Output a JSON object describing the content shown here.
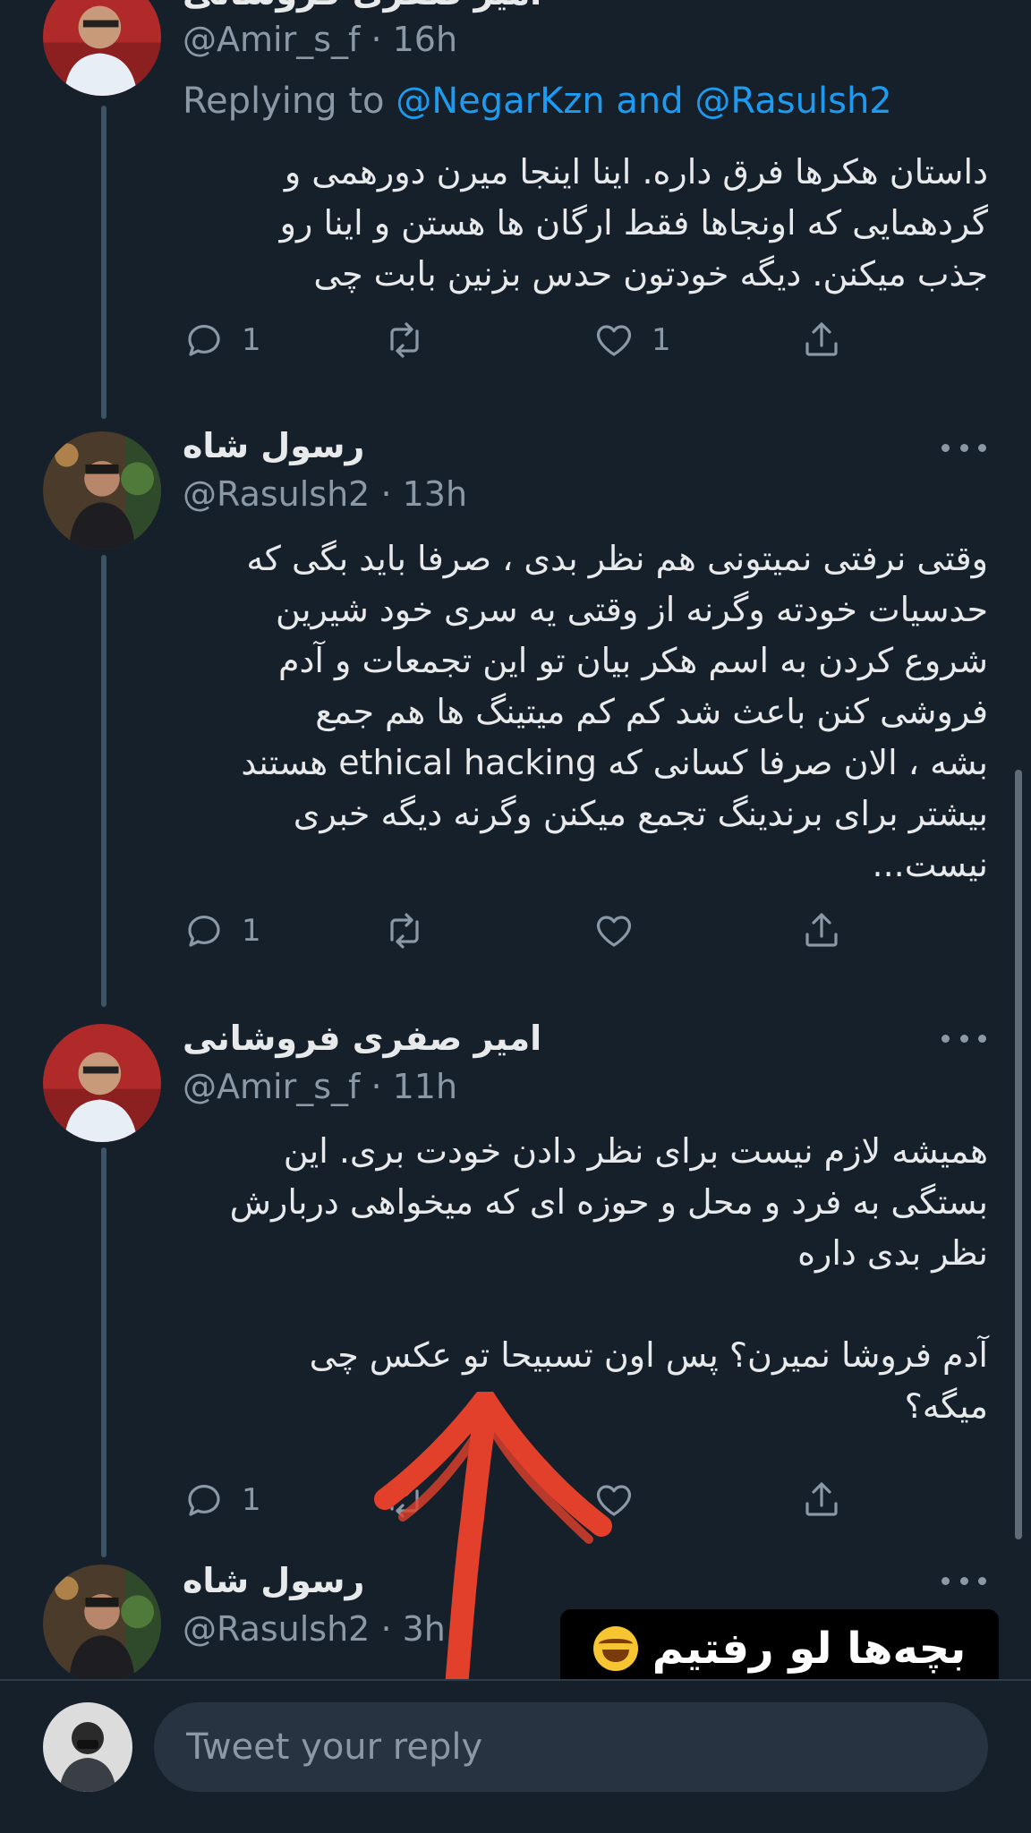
{
  "tweets": [
    {
      "name": "امیر صفری فروشانی",
      "handle": "@Amir_s_f",
      "time": "16h",
      "replying_prefix": "Replying to ",
      "replying_to": "@NegarKzn and @Rasulsh2",
      "text": "داستان هکرها فرق داره. اینا اینجا میرن دورهمی و\nگردهمایی که اونجاها فقط ارگان ها هستن و اینا رو\nجذب میکنن. دیگه خودتون حدس بزنین بابت چی",
      "reply_count": "1",
      "retweet_count": "",
      "like_count": "1"
    },
    {
      "name": "رسول شاه",
      "handle": "@Rasulsh2",
      "time": "13h",
      "text": "وقتی نرفتی نمیتونی هم نظر بدی ، صرفا باید بگی که\nحدسیات خودته وگرنه از وقتی یه سری خود شیرین\nشروع کردن به اسم هکر بیان تو این تجمعات و آدم\nفروشی کنن باعث شد کم کم میتینگ ها هم جمع\nبشه ، الان صرفا کسانی که ethical hacking هستند\nبیشتر برای برندینگ تجمع میکنن وگرنه دیگه خبری\nنیست...",
      "reply_count": "1",
      "retweet_count": "",
      "like_count": ""
    },
    {
      "name": "امیر صفری فروشانی",
      "handle": "@Amir_s_f",
      "time": "11h",
      "text": "همیشه لازم نیست برای نظر دادن خودت بری. این\nبستگی به فرد و محل و حوزه ای که میخواهی دربارش\nنظر بدی داره\n\nآدم فروشا نمیرن؟ پس اون تسبیحا تو عکس چی\nمیگه؟",
      "reply_count": "1",
      "retweet_count": "",
      "like_count": ""
    },
    {
      "name": "رسول شاه",
      "handle": "@Rasulsh2",
      "time": "3h"
    }
  ],
  "sticker": {
    "text": "بچه‌ها لو رفتیم",
    "emoji": "face-with-tears-of-joy"
  },
  "composer": {
    "placeholder": "Tweet your reply"
  },
  "colors": {
    "background": "#15202b",
    "link": "#1d9bf0",
    "secondary": "#8b98a5",
    "arrow": "#e2402b"
  }
}
